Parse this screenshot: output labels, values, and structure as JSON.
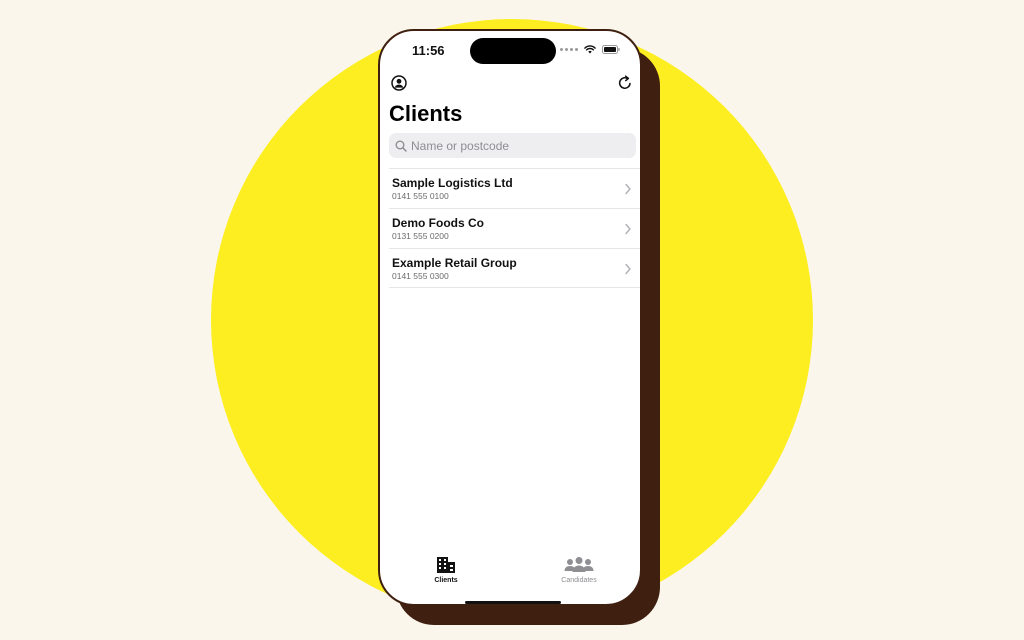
{
  "status_bar": {
    "time": "11:56"
  },
  "header": {
    "title": "Clients",
    "profile_icon": "person-circle-icon",
    "refresh_icon": "refresh-icon"
  },
  "search": {
    "placeholder": "Name or postcode",
    "value": "",
    "icon": "search-icon"
  },
  "clients": [
    {
      "name": "Sample Logistics Ltd",
      "phone": "0141 555 0100"
    },
    {
      "name": "Demo Foods Co",
      "phone": "0131 555 0200"
    },
    {
      "name": "Example Retail Group",
      "phone": "0141 555 0300"
    }
  ],
  "tabs": [
    {
      "label": "Clients",
      "icon": "building-icon",
      "selected": true
    },
    {
      "label": "Candidates",
      "icon": "people-icon",
      "selected": false
    }
  ],
  "colors": {
    "background": "#fbf6ec",
    "accent_circle": "#fdee21",
    "phone_frame": "#3f2010"
  }
}
